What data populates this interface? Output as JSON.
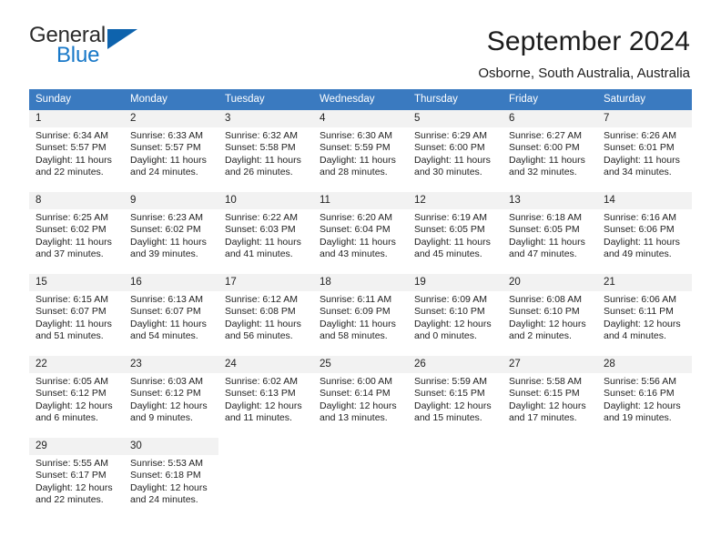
{
  "logo": {
    "word_top": "General",
    "word_bottom": "Blue",
    "triangle_icon": "blue-triangle-icon",
    "color_dark": "#2b2b2b",
    "color_blue": "#1878c8"
  },
  "header": {
    "month_title": "September 2024",
    "location": "Osborne, South Australia, Australia"
  },
  "theme": {
    "header_blue": "#3a7ac0",
    "date_band_gray": "#f2f2f2",
    "text": "#222222"
  },
  "calendar": {
    "weekday_headers": [
      "Sunday",
      "Monday",
      "Tuesday",
      "Wednesday",
      "Thursday",
      "Friday",
      "Saturday"
    ],
    "weeks": [
      [
        {
          "date": "1",
          "sunrise": "Sunrise: 6:34 AM",
          "sunset": "Sunset: 5:57 PM",
          "daylight_line1": "Daylight: 11 hours",
          "daylight_line2": "and 22 minutes."
        },
        {
          "date": "2",
          "sunrise": "Sunrise: 6:33 AM",
          "sunset": "Sunset: 5:57 PM",
          "daylight_line1": "Daylight: 11 hours",
          "daylight_line2": "and 24 minutes."
        },
        {
          "date": "3",
          "sunrise": "Sunrise: 6:32 AM",
          "sunset": "Sunset: 5:58 PM",
          "daylight_line1": "Daylight: 11 hours",
          "daylight_line2": "and 26 minutes."
        },
        {
          "date": "4",
          "sunrise": "Sunrise: 6:30 AM",
          "sunset": "Sunset: 5:59 PM",
          "daylight_line1": "Daylight: 11 hours",
          "daylight_line2": "and 28 minutes."
        },
        {
          "date": "5",
          "sunrise": "Sunrise: 6:29 AM",
          "sunset": "Sunset: 6:00 PM",
          "daylight_line1": "Daylight: 11 hours",
          "daylight_line2": "and 30 minutes."
        },
        {
          "date": "6",
          "sunrise": "Sunrise: 6:27 AM",
          "sunset": "Sunset: 6:00 PM",
          "daylight_line1": "Daylight: 11 hours",
          "daylight_line2": "and 32 minutes."
        },
        {
          "date": "7",
          "sunrise": "Sunrise: 6:26 AM",
          "sunset": "Sunset: 6:01 PM",
          "daylight_line1": "Daylight: 11 hours",
          "daylight_line2": "and 34 minutes."
        }
      ],
      [
        {
          "date": "8",
          "sunrise": "Sunrise: 6:25 AM",
          "sunset": "Sunset: 6:02 PM",
          "daylight_line1": "Daylight: 11 hours",
          "daylight_line2": "and 37 minutes."
        },
        {
          "date": "9",
          "sunrise": "Sunrise: 6:23 AM",
          "sunset": "Sunset: 6:02 PM",
          "daylight_line1": "Daylight: 11 hours",
          "daylight_line2": "and 39 minutes."
        },
        {
          "date": "10",
          "sunrise": "Sunrise: 6:22 AM",
          "sunset": "Sunset: 6:03 PM",
          "daylight_line1": "Daylight: 11 hours",
          "daylight_line2": "and 41 minutes."
        },
        {
          "date": "11",
          "sunrise": "Sunrise: 6:20 AM",
          "sunset": "Sunset: 6:04 PM",
          "daylight_line1": "Daylight: 11 hours",
          "daylight_line2": "and 43 minutes."
        },
        {
          "date": "12",
          "sunrise": "Sunrise: 6:19 AM",
          "sunset": "Sunset: 6:05 PM",
          "daylight_line1": "Daylight: 11 hours",
          "daylight_line2": "and 45 minutes."
        },
        {
          "date": "13",
          "sunrise": "Sunrise: 6:18 AM",
          "sunset": "Sunset: 6:05 PM",
          "daylight_line1": "Daylight: 11 hours",
          "daylight_line2": "and 47 minutes."
        },
        {
          "date": "14",
          "sunrise": "Sunrise: 6:16 AM",
          "sunset": "Sunset: 6:06 PM",
          "daylight_line1": "Daylight: 11 hours",
          "daylight_line2": "and 49 minutes."
        }
      ],
      [
        {
          "date": "15",
          "sunrise": "Sunrise: 6:15 AM",
          "sunset": "Sunset: 6:07 PM",
          "daylight_line1": "Daylight: 11 hours",
          "daylight_line2": "and 51 minutes."
        },
        {
          "date": "16",
          "sunrise": "Sunrise: 6:13 AM",
          "sunset": "Sunset: 6:07 PM",
          "daylight_line1": "Daylight: 11 hours",
          "daylight_line2": "and 54 minutes."
        },
        {
          "date": "17",
          "sunrise": "Sunrise: 6:12 AM",
          "sunset": "Sunset: 6:08 PM",
          "daylight_line1": "Daylight: 11 hours",
          "daylight_line2": "and 56 minutes."
        },
        {
          "date": "18",
          "sunrise": "Sunrise: 6:11 AM",
          "sunset": "Sunset: 6:09 PM",
          "daylight_line1": "Daylight: 11 hours",
          "daylight_line2": "and 58 minutes."
        },
        {
          "date": "19",
          "sunrise": "Sunrise: 6:09 AM",
          "sunset": "Sunset: 6:10 PM",
          "daylight_line1": "Daylight: 12 hours",
          "daylight_line2": "and 0 minutes."
        },
        {
          "date": "20",
          "sunrise": "Sunrise: 6:08 AM",
          "sunset": "Sunset: 6:10 PM",
          "daylight_line1": "Daylight: 12 hours",
          "daylight_line2": "and 2 minutes."
        },
        {
          "date": "21",
          "sunrise": "Sunrise: 6:06 AM",
          "sunset": "Sunset: 6:11 PM",
          "daylight_line1": "Daylight: 12 hours",
          "daylight_line2": "and 4 minutes."
        }
      ],
      [
        {
          "date": "22",
          "sunrise": "Sunrise: 6:05 AM",
          "sunset": "Sunset: 6:12 PM",
          "daylight_line1": "Daylight: 12 hours",
          "daylight_line2": "and 6 minutes."
        },
        {
          "date": "23",
          "sunrise": "Sunrise: 6:03 AM",
          "sunset": "Sunset: 6:12 PM",
          "daylight_line1": "Daylight: 12 hours",
          "daylight_line2": "and 9 minutes."
        },
        {
          "date": "24",
          "sunrise": "Sunrise: 6:02 AM",
          "sunset": "Sunset: 6:13 PM",
          "daylight_line1": "Daylight: 12 hours",
          "daylight_line2": "and 11 minutes."
        },
        {
          "date": "25",
          "sunrise": "Sunrise: 6:00 AM",
          "sunset": "Sunset: 6:14 PM",
          "daylight_line1": "Daylight: 12 hours",
          "daylight_line2": "and 13 minutes."
        },
        {
          "date": "26",
          "sunrise": "Sunrise: 5:59 AM",
          "sunset": "Sunset: 6:15 PM",
          "daylight_line1": "Daylight: 12 hours",
          "daylight_line2": "and 15 minutes."
        },
        {
          "date": "27",
          "sunrise": "Sunrise: 5:58 AM",
          "sunset": "Sunset: 6:15 PM",
          "daylight_line1": "Daylight: 12 hours",
          "daylight_line2": "and 17 minutes."
        },
        {
          "date": "28",
          "sunrise": "Sunrise: 5:56 AM",
          "sunset": "Sunset: 6:16 PM",
          "daylight_line1": "Daylight: 12 hours",
          "daylight_line2": "and 19 minutes."
        }
      ],
      [
        {
          "date": "29",
          "sunrise": "Sunrise: 5:55 AM",
          "sunset": "Sunset: 6:17 PM",
          "daylight_line1": "Daylight: 12 hours",
          "daylight_line2": "and 22 minutes."
        },
        {
          "date": "30",
          "sunrise": "Sunrise: 5:53 AM",
          "sunset": "Sunset: 6:18 PM",
          "daylight_line1": "Daylight: 12 hours",
          "daylight_line2": "and 24 minutes."
        },
        {
          "date": "",
          "sunrise": "",
          "sunset": "",
          "daylight_line1": "",
          "daylight_line2": ""
        },
        {
          "date": "",
          "sunrise": "",
          "sunset": "",
          "daylight_line1": "",
          "daylight_line2": ""
        },
        {
          "date": "",
          "sunrise": "",
          "sunset": "",
          "daylight_line1": "",
          "daylight_line2": ""
        },
        {
          "date": "",
          "sunrise": "",
          "sunset": "",
          "daylight_line1": "",
          "daylight_line2": ""
        },
        {
          "date": "",
          "sunrise": "",
          "sunset": "",
          "daylight_line1": "",
          "daylight_line2": ""
        }
      ]
    ]
  }
}
